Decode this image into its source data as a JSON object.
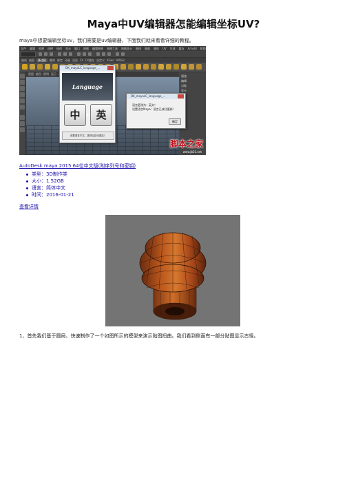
{
  "article": {
    "title": "Maya中UV编辑器怎能编辑坐标UV?",
    "intro": "maya中想要编辑坐标uv，我们需要是uv编辑器，下面我们就来看看详细的教程。",
    "step1": "1、首先我们基于圆局、快速制作了一个如图所示的模型来演示贴图扭曲。我们看到侧面有一部分贴图显示古怪。"
  },
  "screenshot": {
    "menu_items": [
      "文件",
      "编辑",
      "创建",
      "选择",
      "修改",
      "显示",
      "窗口",
      "网格",
      "编辑网格",
      "网格工具",
      "网格显示",
      "曲线",
      "曲面",
      "变形",
      "UV",
      "生成",
      "缓存",
      "Arnold",
      "帮助"
    ],
    "shelf_tabs": [
      "曲线",
      "曲面",
      "多边形",
      "雕刻",
      "绑定",
      "动画",
      "渲染",
      "FX",
      "FX缓存",
      "自定义",
      "XGen",
      "MASH"
    ],
    "panel_menu": [
      "视图",
      "着色",
      "照明",
      "显示",
      "渲染器",
      "面板"
    ],
    "channel_box": [
      "通道",
      "编辑",
      "对象",
      "显示"
    ],
    "lc_window_title": "DK_mayaLC_language_...",
    "lc_banner": "Language Changer",
    "lc_buttons": [
      "中",
      "英"
    ],
    "lc_footer": "设置语言中文，选择后启动重启！",
    "dialog_title": "DK_mayaLC_language_...",
    "dialog_message": [
      "语言更改为：英文！",
      "设置语言Maya：语言已成功更新!"
    ],
    "dialog_ok": "确定",
    "watermark": "脚本之家",
    "watermark_sub": "www.jb51.net"
  },
  "download": {
    "link_text": "AutoDesk maya 2015 64位中文版(附序列号和密钥)",
    "info": [
      "类型：3D制作类",
      "大小：1.52GB",
      "语言：简体中文",
      "时间：2016-01-21"
    ],
    "more_link": "查看详情"
  }
}
